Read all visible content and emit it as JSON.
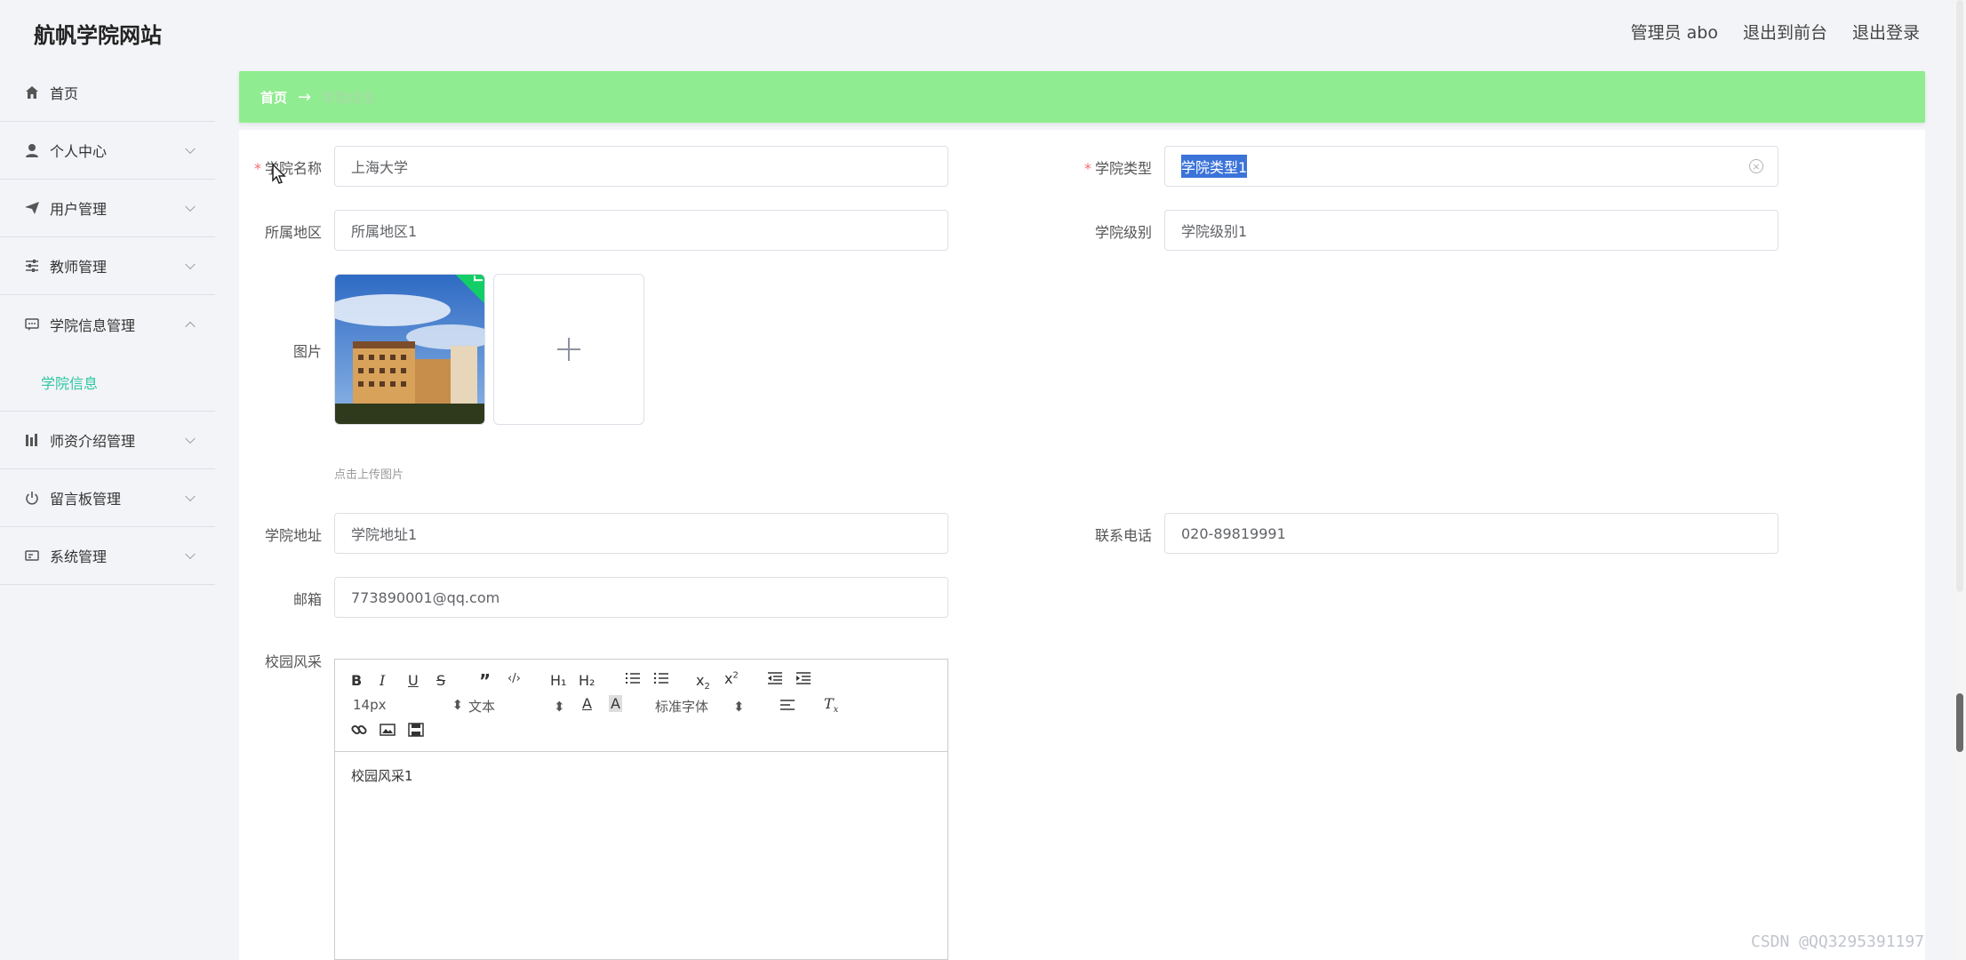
{
  "header": {
    "site_title": "航帆学院网站",
    "user": "管理员 abo",
    "to_front": "退出到前台",
    "logout": "退出登录"
  },
  "sidebar": {
    "items": [
      {
        "label": "首页",
        "icon": "home-icon"
      },
      {
        "label": "个人中心",
        "icon": "user-icon"
      },
      {
        "label": "用户管理",
        "icon": "send-icon"
      },
      {
        "label": "教师管理",
        "icon": "sliders-icon"
      },
      {
        "label": "学院信息管理",
        "icon": "chat-icon",
        "expanded": true
      },
      {
        "label": "学院信息",
        "sub": true,
        "active": true
      },
      {
        "label": "师资介绍管理",
        "icon": "chart-icon"
      },
      {
        "label": "留言板管理",
        "icon": "power-icon"
      },
      {
        "label": "系统管理",
        "icon": "card-icon"
      }
    ]
  },
  "breadcrumb": {
    "home": "首页",
    "separator": "→",
    "current": "学院信息"
  },
  "form": {
    "college_name": {
      "label": "学院名称",
      "value": "上海大学",
      "required": true
    },
    "college_type": {
      "label": "学院类型",
      "value": "学院类型1",
      "required": true
    },
    "region": {
      "label": "所属地区",
      "value": "所属地区1"
    },
    "level": {
      "label": "学院级别",
      "value": "学院级别1"
    },
    "image": {
      "label": "图片",
      "upload_tip": "点击上传图片"
    },
    "address": {
      "label": "学院地址",
      "value": "学院地址1"
    },
    "phone": {
      "label": "联系电话",
      "value": "020-89819991"
    },
    "email": {
      "label": "邮箱",
      "value": "773890001@qq.com"
    },
    "campus": {
      "label": "校园风采",
      "value": "校园风采1"
    }
  },
  "editor": {
    "font_size": "14px",
    "text_type": "文本",
    "font_family": "标准字体",
    "h1": "H₁",
    "h2": "H₂"
  },
  "colors": {
    "breadcrumb_bg": "#90ec90",
    "active_menu": "#2ec6a4",
    "required": "#f56c6c"
  },
  "watermark": "CSDN @QQ3295391197"
}
